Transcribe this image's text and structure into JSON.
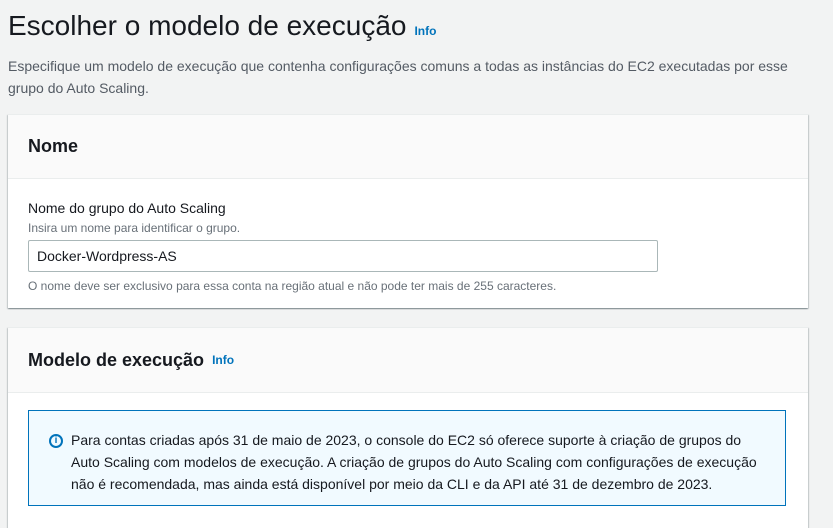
{
  "page": {
    "title": "Escolher o modelo de execução",
    "info": "Info",
    "description": "Especifique um modelo de execução que contenha configurações comuns a todas as instâncias do EC2 executadas por esse grupo do Auto Scaling."
  },
  "name_section": {
    "title": "Nome",
    "field_label": "Nome do grupo do Auto Scaling",
    "field_description": "Insira um nome para identificar o grupo.",
    "field_value": "Docker-Wordpress-AS",
    "constraint": "O nome deve ser exclusivo para essa conta na região atual e não pode ter mais de 255 caracteres."
  },
  "launch_template_section": {
    "title": "Modelo de execução",
    "info": "Info",
    "alert_icon": "info-circle-icon",
    "alert_text": "Para contas criadas após 31 de maio de 2023, o console do EC2 só oferece suporte à criação de grupos do Auto Scaling com modelos de execução. A criação de grupos do Auto Scaling com configurações de execução não é recomendada, mas ainda está disponível por meio da CLI e da API até 31 de dezembro de 2023."
  },
  "colors": {
    "link": "#0073bb",
    "alert_border": "#0073bb",
    "alert_background": "#f1faff"
  }
}
